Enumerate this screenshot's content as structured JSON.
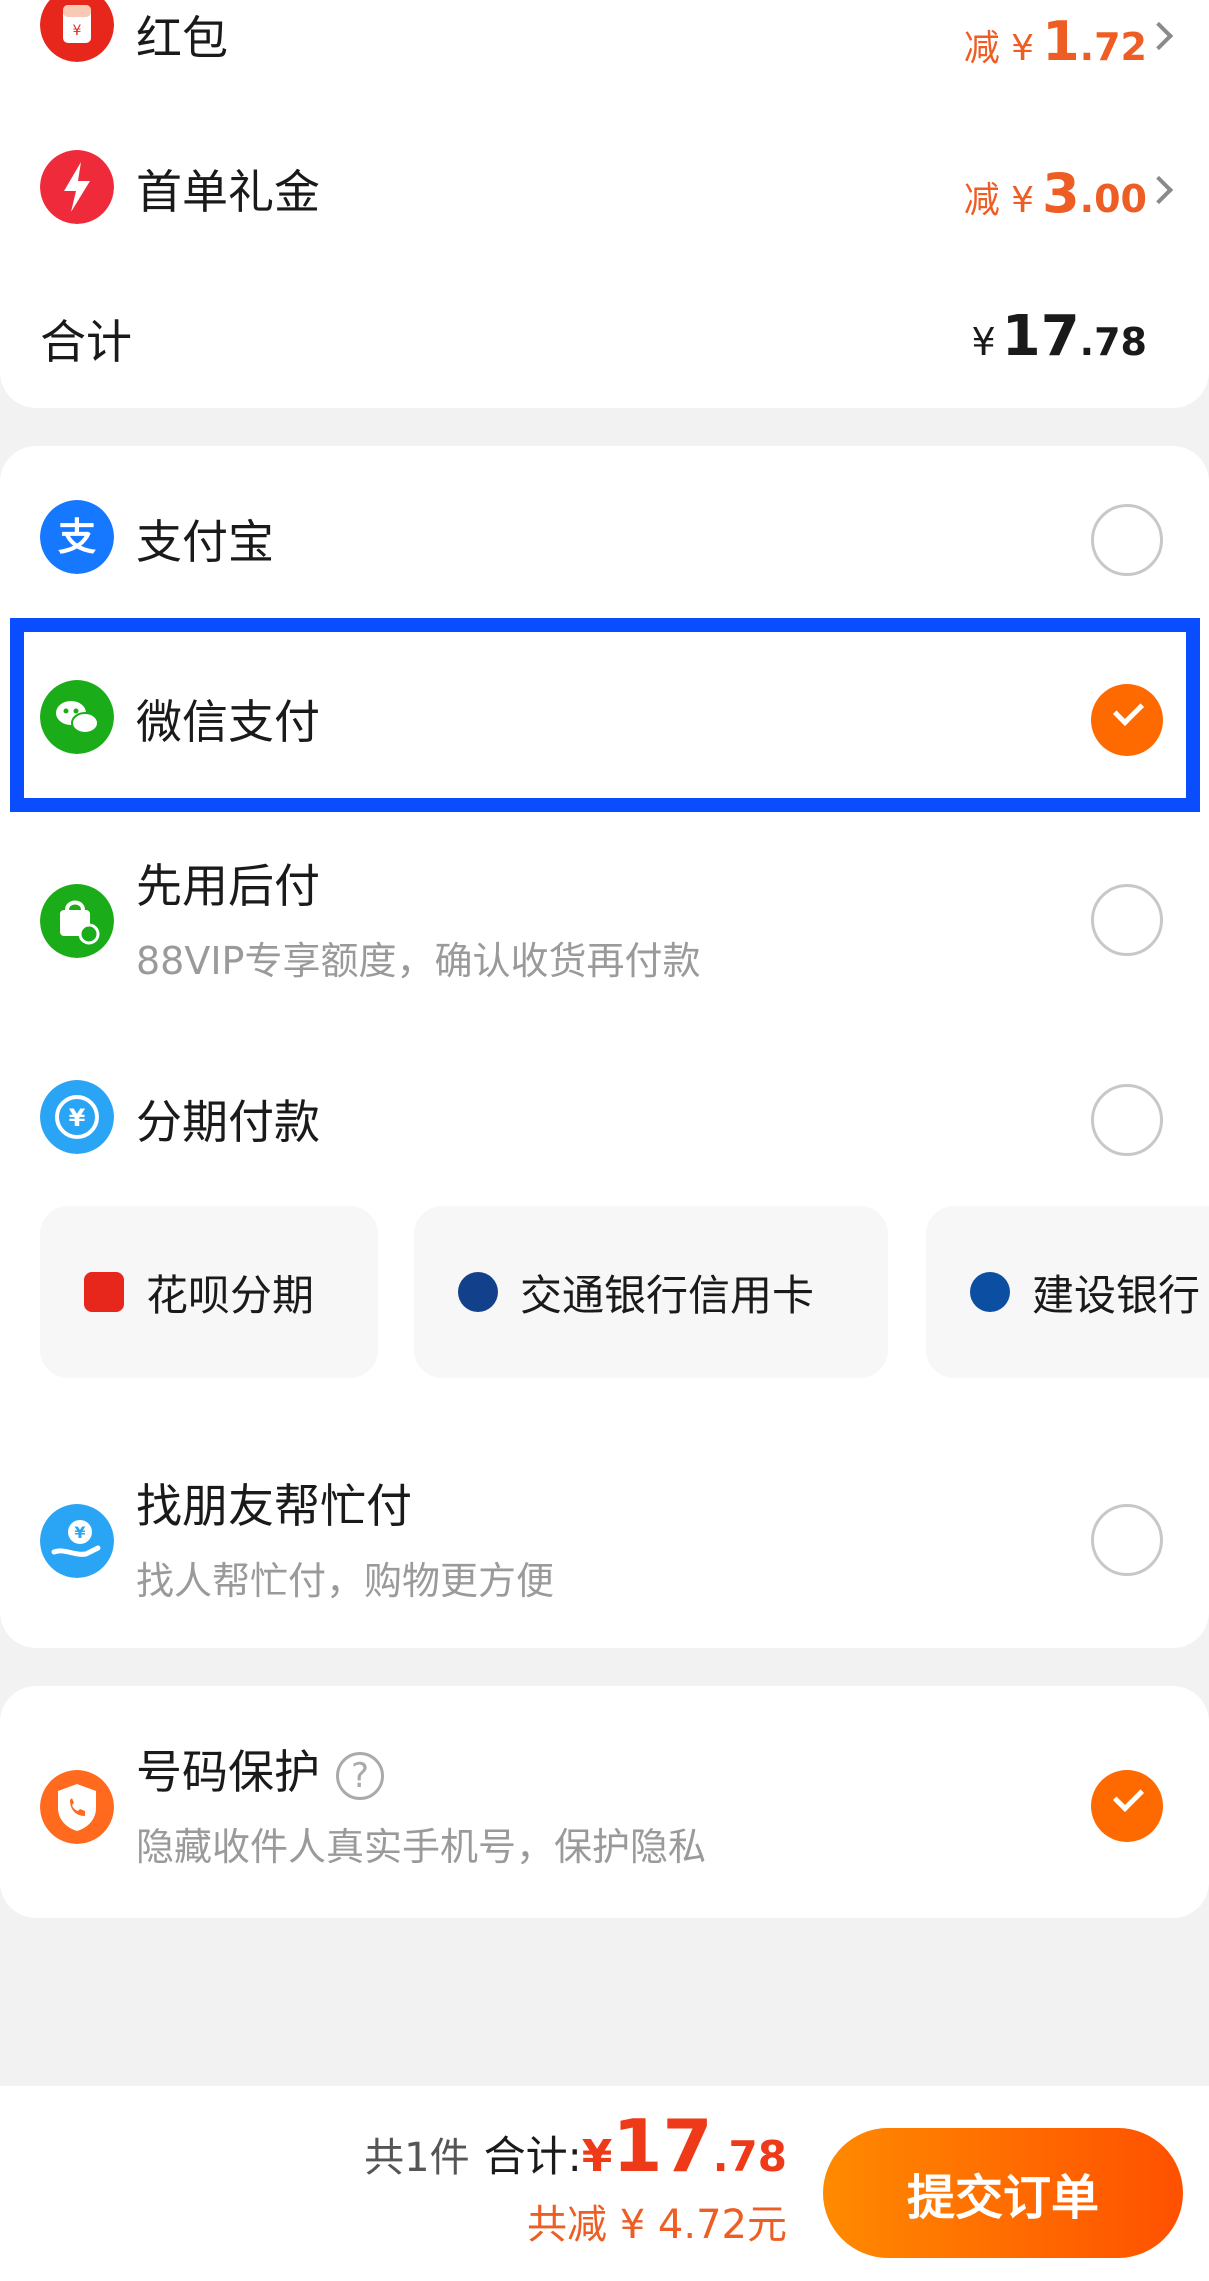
{
  "discounts": [
    {
      "label": "红包",
      "pre": "减 ¥",
      "big": "1",
      "small": ".72"
    },
    {
      "label": "首单礼金",
      "pre": "减 ¥",
      "big": "3",
      "small": ".00"
    }
  ],
  "subtotal": {
    "label": "合计",
    "yen": "¥",
    "big": "17",
    "small": ".78"
  },
  "payment_methods": [
    {
      "label": "支付宝",
      "sub": "",
      "selected": false
    },
    {
      "label": "微信支付",
      "sub": "",
      "selected": true
    },
    {
      "label": "先用后付",
      "sub": "88VIP专享额度，确认收货再付款",
      "selected": false
    },
    {
      "label": "分期付款",
      "sub": "",
      "selected": false
    },
    {
      "label": "找朋友帮忙付",
      "sub": "找人帮忙付，购物更方便",
      "selected": false
    }
  ],
  "installment_options": [
    {
      "label": "花呗分期"
    },
    {
      "label": "交通银行信用卡"
    },
    {
      "label": "建设银行"
    }
  ],
  "protection": {
    "label": "号码保护",
    "help": "?",
    "sub": "隐藏收件人真实手机号，保护隐私",
    "selected": true
  },
  "footer": {
    "count": "共1件",
    "total_label": "合计:",
    "yen": "¥",
    "big": "17",
    "small": ".78",
    "saved": "共减 ¥ 4.72元",
    "submit": "提交订单"
  },
  "colors": {
    "accent": "#ff6a00",
    "price": "#ee3a18",
    "highlight": "#0a4dff"
  }
}
